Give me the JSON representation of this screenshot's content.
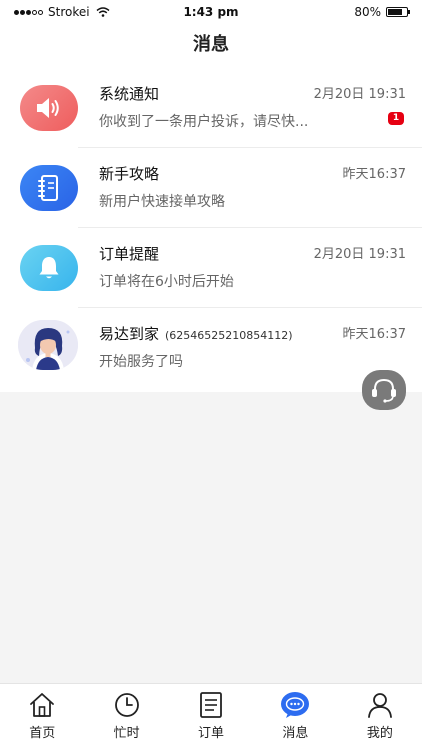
{
  "status_bar": {
    "carrier": "Strokei",
    "time": "1:43 pm",
    "battery": "80%",
    "battery_level": 0.8
  },
  "header": {
    "title": "消息"
  },
  "messages": [
    {
      "title": "系统通知",
      "time": "2月20日 19:31",
      "preview": "你收到了一条用户投诉，请尽快...",
      "badge": "1",
      "icon": "megaphone-icon",
      "color": "#ef6b6b"
    },
    {
      "title": "新手攻略",
      "time": "昨天16:37",
      "preview": "新用户快速接单攻略",
      "icon": "notebook-icon",
      "color": "#2d6cf0"
    },
    {
      "title": "订单提醒",
      "time": "2月20日 19:31",
      "preview": "订单将在6小时后开始",
      "icon": "bell-icon",
      "color": "#45bdf0"
    },
    {
      "title": "易达到家",
      "subtitle": "(62546525210854112)",
      "time": "昨天16:37",
      "preview": "开始服务了吗",
      "icon": "person-avatar"
    }
  ],
  "floating_button": {
    "icon": "headset-icon"
  },
  "tabbar": {
    "active": "消息",
    "accent": "#2d6cf0",
    "tabs": [
      {
        "label": "首页",
        "icon": "home-icon"
      },
      {
        "label": "忙时",
        "icon": "clock-icon"
      },
      {
        "label": "订单",
        "icon": "order-list-icon"
      },
      {
        "label": "消息",
        "icon": "chat-bubble-icon"
      },
      {
        "label": "我的",
        "icon": "user-icon"
      }
    ]
  }
}
